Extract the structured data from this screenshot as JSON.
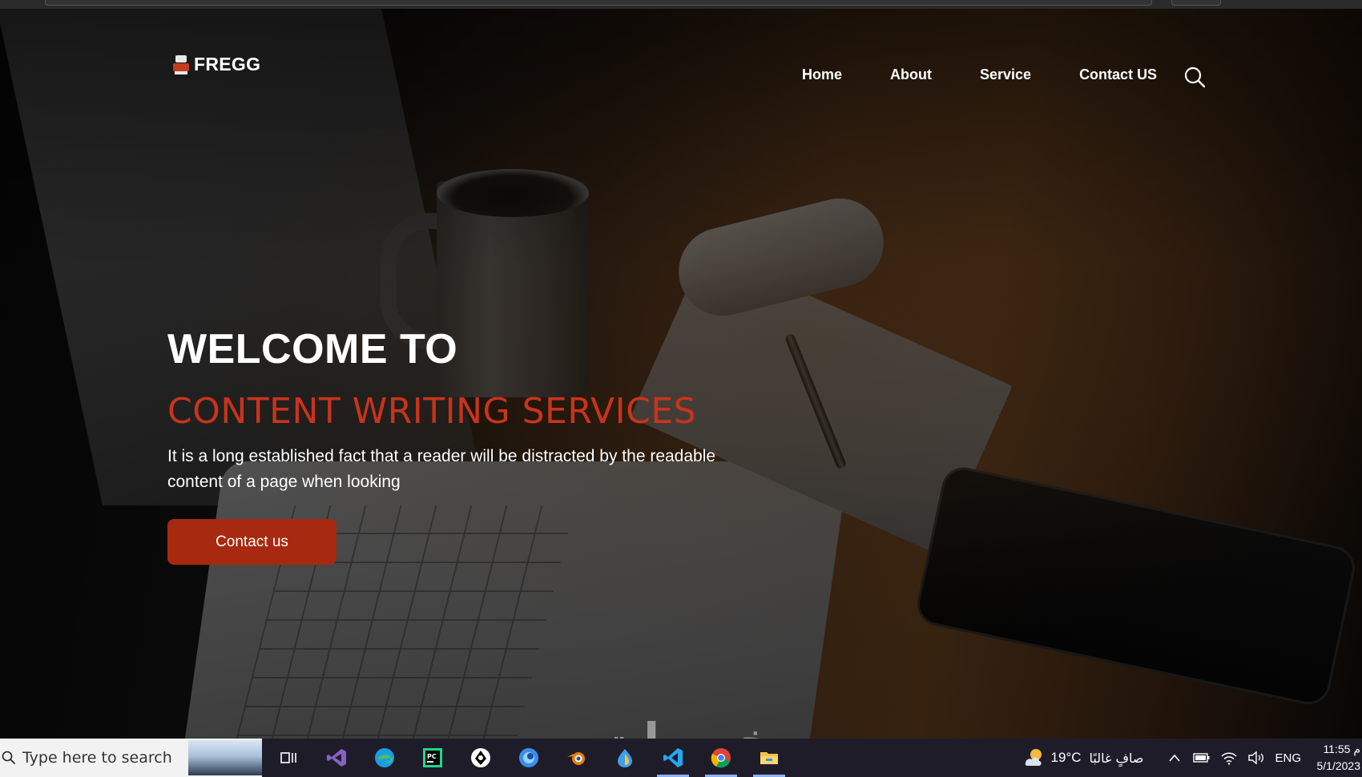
{
  "brand": {
    "name": "FREGG",
    "accent": "#c8341c",
    "button_color": "#a7290f"
  },
  "nav": {
    "links": [
      {
        "label": "Home"
      },
      {
        "label": "About"
      },
      {
        "label": "Service"
      },
      {
        "label": "Contact US"
      }
    ],
    "search_icon": "search-icon"
  },
  "hero": {
    "headline": "WELCOME TO",
    "subheadline": "CONTENT WRITING SERVICES",
    "lead": "It is a long established fact that a reader will be distracted by the readable content of a page when looking",
    "cta_label": "Contact us"
  },
  "watermark": "خمسات",
  "taskbar": {
    "search_placeholder": "Type here to search",
    "apps": [
      "task-view-icon",
      "visual-studio-icon",
      "edge-icon",
      "pycharm-icon",
      "inkscape-icon",
      "firefox-dev-icon",
      "blender-icon",
      "app-icon",
      "vscode-icon",
      "chrome-icon",
      "file-explorer-icon"
    ],
    "weather": {
      "temperature": "19°C",
      "condition": "صافٍ غالبًا"
    },
    "language": "ENG",
    "time": "11:55 م",
    "date": "5/1/2023"
  }
}
